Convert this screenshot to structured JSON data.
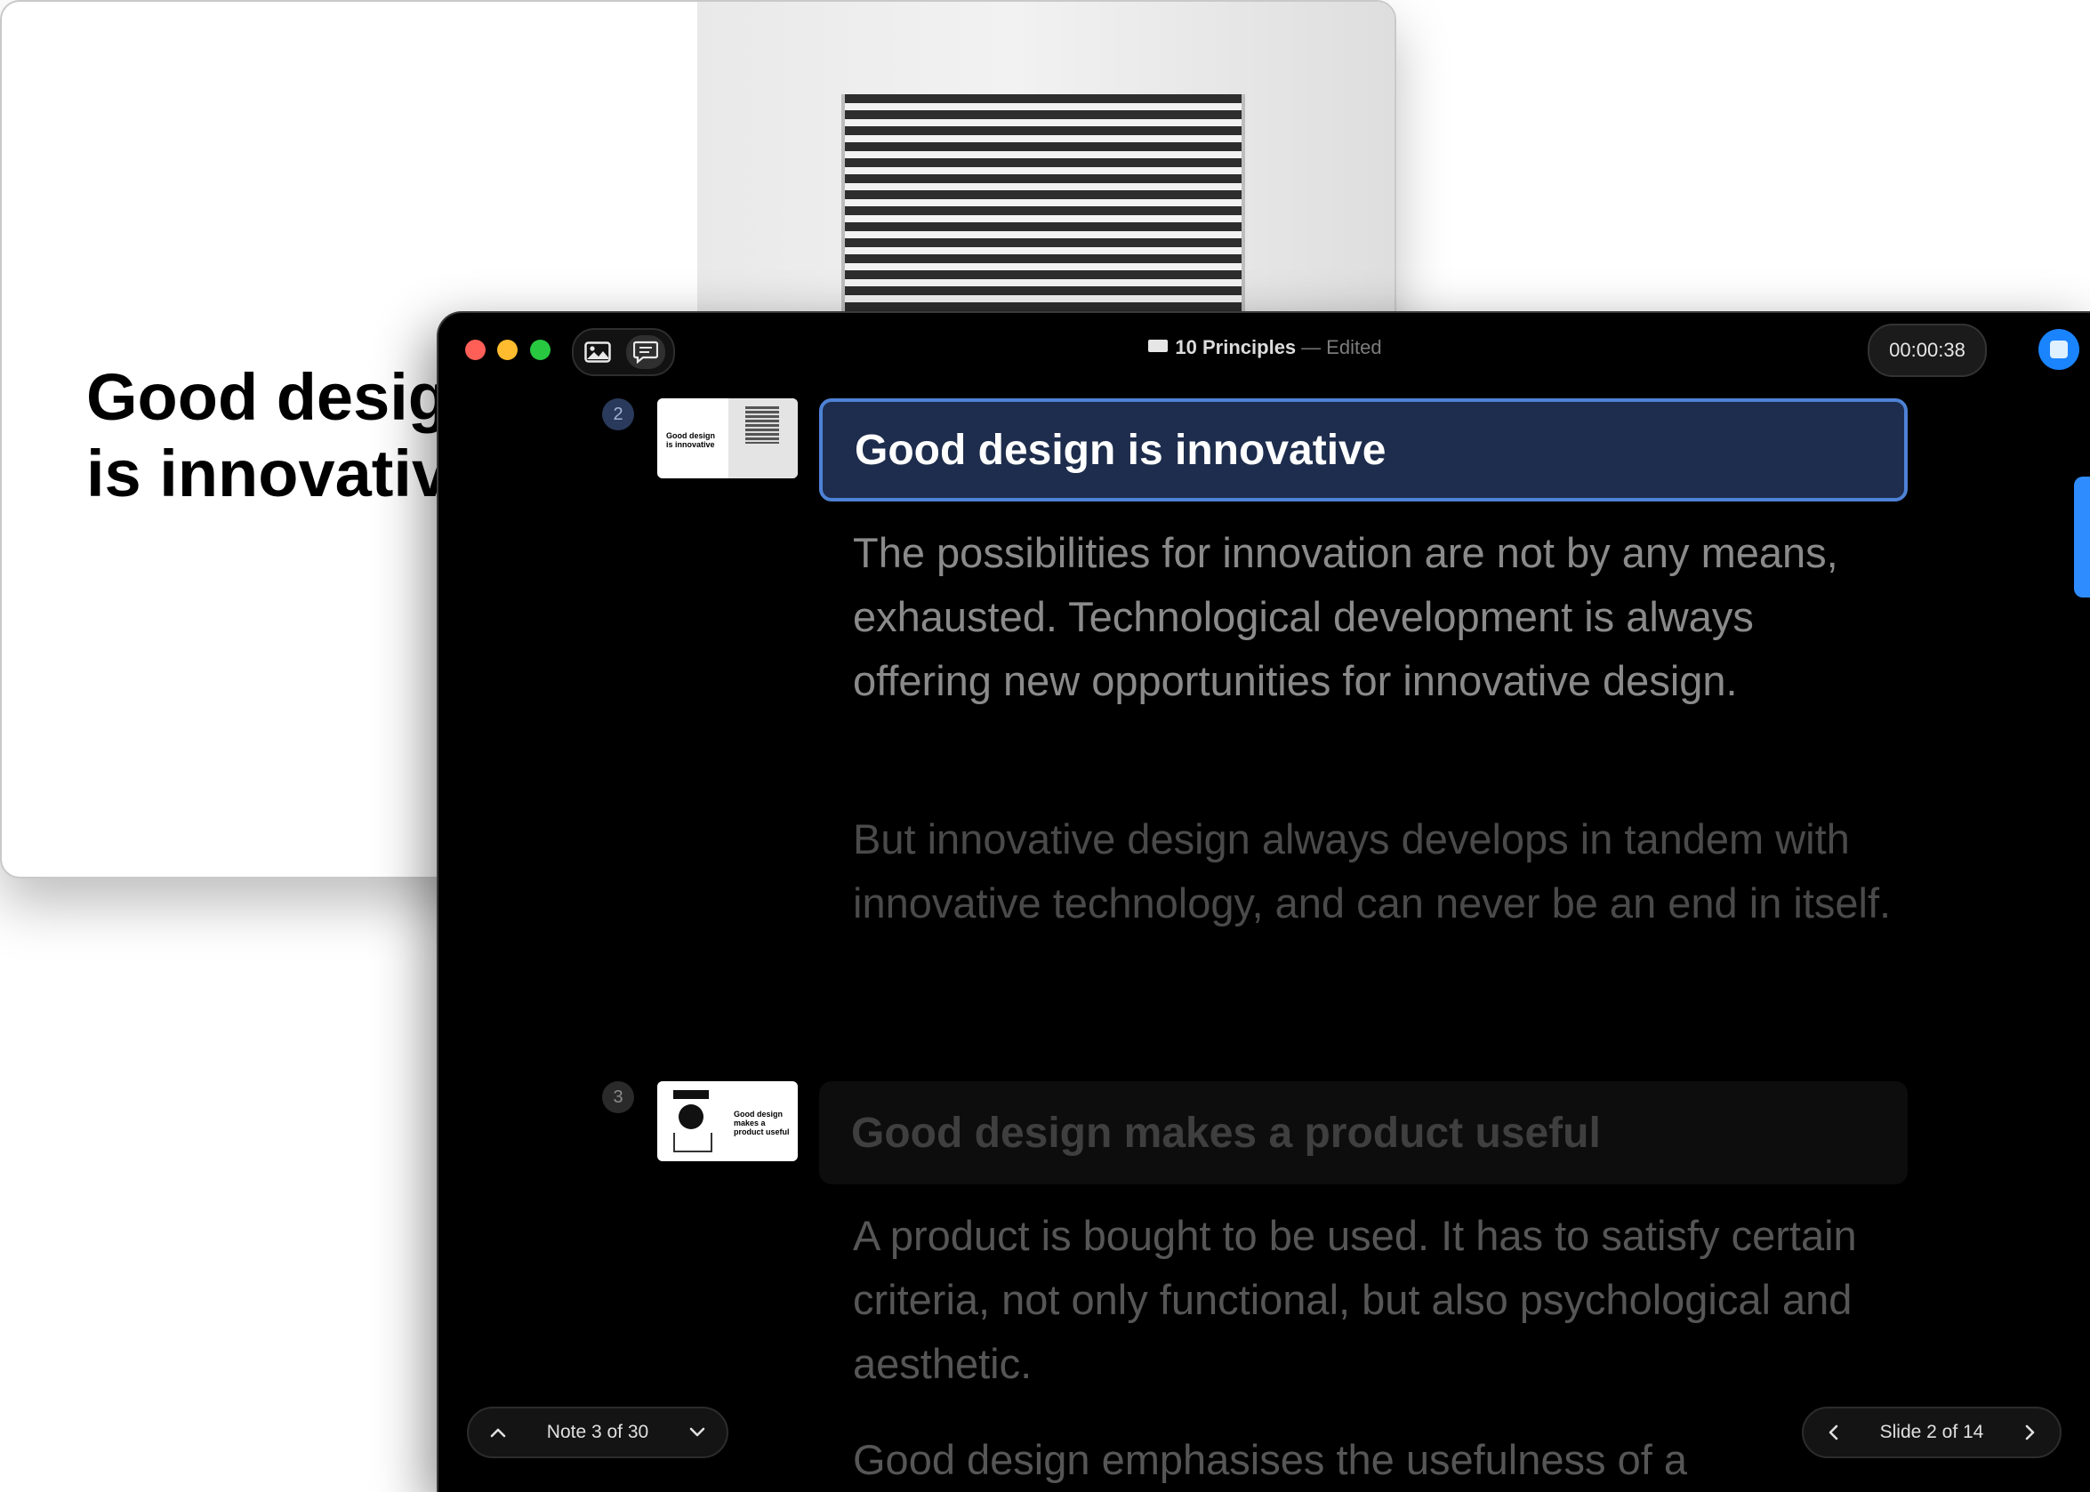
{
  "slide_preview": {
    "title": "Good design\nis innovative"
  },
  "window": {
    "title": "10 Principles",
    "separator": "—",
    "status": "Edited",
    "timer": "00:00:38"
  },
  "notes": [
    {
      "number": "2",
      "thumb_text": "Good design\nis innovative",
      "title": "Good design is innovative",
      "paragraphs": [
        "The possibilities for innovation are not by any means, exhausted. Technological development is always offering new opportunities for innovative design.",
        "But innovative design always develops in tandem with innovative technology, and can never be an end in itself."
      ]
    },
    {
      "number": "3",
      "thumb_text": "Good design\nmakes a\nproduct useful",
      "title": "Good design makes a product useful",
      "paragraphs": [
        "A product is bought to be used. It has to satisfy certain criteria, not only functional, but also psychological and aesthetic.",
        "Good design emphasises the usefulness of a"
      ]
    }
  ],
  "footer": {
    "note_counter": "Note 3 of 30",
    "slide_counter": "Slide 2 of 14"
  },
  "colors": {
    "accent": "#1a84ff",
    "active_title_bg": "#1e2d4d",
    "active_title_border": "#4e82d6"
  },
  "icons": [
    "image-icon",
    "notes-icon",
    "document-icon",
    "stop-icon",
    "chevron-up-icon",
    "chevron-down-icon",
    "chevron-left-icon",
    "chevron-right-icon"
  ]
}
